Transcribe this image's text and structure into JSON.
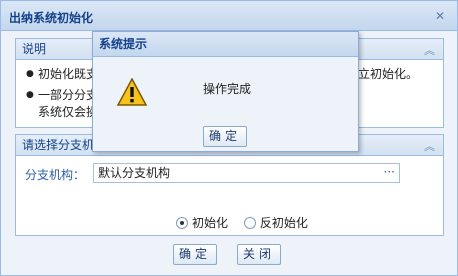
{
  "window": {
    "title": "出纳系统初始化"
  },
  "info_panel": {
    "heading": "说明",
    "bullets": [
      {
        "before": "初始化既支",
        "after": "独立初始化。"
      },
      {
        "before": "一部分分支",
        "line2": "系统仅会操"
      }
    ]
  },
  "select_panel": {
    "heading": "请选择分支机",
    "branch_label": "分支机构：",
    "branch_value": "默认分支机构",
    "branch_button": "···",
    "radio_init": "初始化",
    "radio_reinit": "反初始化"
  },
  "buttons": {
    "ok": "确定",
    "close": "关闭"
  },
  "dialog": {
    "title": "系统提示",
    "message": "操作完成",
    "ok": "确定"
  }
}
